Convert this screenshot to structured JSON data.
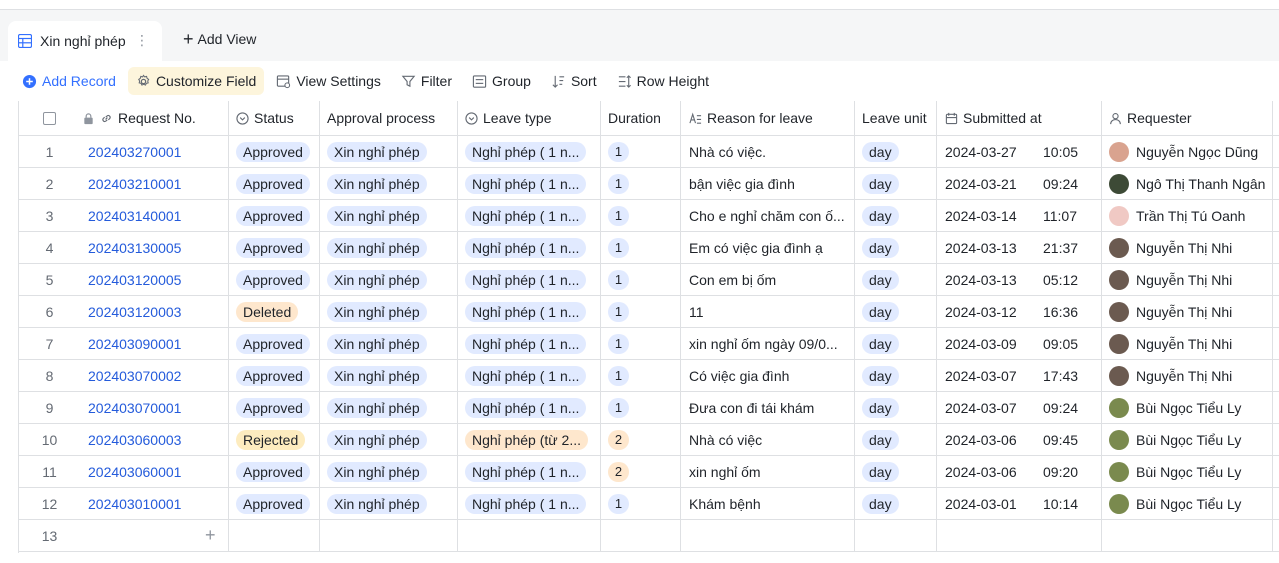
{
  "tabs": {
    "active_label": "Xin nghỉ phép",
    "add_view_label": "Add View"
  },
  "toolbar": {
    "add_record": "Add Record",
    "customize_field": "Customize Field",
    "view_settings": "View Settings",
    "filter": "Filter",
    "group": "Group",
    "sort": "Sort",
    "row_height": "Row Height"
  },
  "columns": {
    "request_no": "Request No.",
    "status": "Status",
    "approval_process": "Approval process",
    "leave_type": "Leave type",
    "duration": "Duration",
    "reason": "Reason for leave",
    "leave_unit": "Leave unit",
    "submitted_at": "Submitted at",
    "requester": "Requester"
  },
  "colors": {
    "accent": "#3370ff",
    "link": "#245bdb",
    "status_approved": "#e1eaff",
    "status_deleted": "#fee7cd",
    "status_rejected": "#fdecbf"
  },
  "rows": [
    {
      "idx": "1",
      "req": "202403270001",
      "status": "Approved",
      "approval": "Xin nghỉ phép",
      "type": "Nghỉ phép ( 1 n...",
      "duration": "1",
      "reason": "Nhà có việc.",
      "unit": "day",
      "date": "2024-03-27",
      "time": "10:05",
      "requester": "Nguyễn Ngọc Dũng",
      "avatar_color": "#d9a38f"
    },
    {
      "idx": "2",
      "req": "202403210001",
      "status": "Approved",
      "approval": "Xin nghỉ phép",
      "type": "Nghỉ phép ( 1 n...",
      "duration": "1",
      "reason": "bận việc gia đình",
      "unit": "day",
      "date": "2024-03-21",
      "time": "09:24",
      "requester": "Ngô Thị Thanh Ngân",
      "avatar_color": "#3d4a36"
    },
    {
      "idx": "3",
      "req": "202403140001",
      "status": "Approved",
      "approval": "Xin nghỉ phép",
      "type": "Nghỉ phép ( 1 n...",
      "duration": "1",
      "reason": "Cho e nghỉ chăm con ố...",
      "unit": "day",
      "date": "2024-03-14",
      "time": "11:07",
      "requester": "Trần Thị Tú Oanh",
      "avatar_color": "#f0c9c4"
    },
    {
      "idx": "4",
      "req": "202403130005",
      "status": "Approved",
      "approval": "Xin nghỉ phép",
      "type": "Nghỉ phép ( 1 n...",
      "duration": "1",
      "reason": "Em có việc gia đình ạ",
      "unit": "day",
      "date": "2024-03-13",
      "time": "21:37",
      "requester": "Nguyễn Thị  Nhi",
      "avatar_color": "#6b5a50"
    },
    {
      "idx": "5",
      "req": "202403120005",
      "status": "Approved",
      "approval": "Xin nghỉ phép",
      "type": "Nghỉ phép ( 1 n...",
      "duration": "1",
      "reason": "Con em bị ốm",
      "unit": "day",
      "date": "2024-03-13",
      "time": "05:12",
      "requester": "Nguyễn Thị  Nhi",
      "avatar_color": "#6b5a50"
    },
    {
      "idx": "6",
      "req": "202403120003",
      "status": "Deleted",
      "approval": "Xin nghỉ phép",
      "type": "Nghỉ phép ( 1 n...",
      "duration": "1",
      "reason": "11",
      "unit": "day",
      "date": "2024-03-12",
      "time": "16:36",
      "requester": "Nguyễn Thị  Nhi",
      "avatar_color": "#6b5a50"
    },
    {
      "idx": "7",
      "req": "202403090001",
      "status": "Approved",
      "approval": "Xin nghỉ phép",
      "type": "Nghỉ phép ( 1 n...",
      "duration": "1",
      "reason": "xin nghỉ ốm ngày 09/0...",
      "unit": "day",
      "date": "2024-03-09",
      "time": "09:05",
      "requester": "Nguyễn Thị  Nhi",
      "avatar_color": "#6b5a50"
    },
    {
      "idx": "8",
      "req": "202403070002",
      "status": "Approved",
      "approval": "Xin nghỉ phép",
      "type": "Nghỉ phép ( 1 n...",
      "duration": "1",
      "reason": "Có việc gia đình",
      "unit": "day",
      "date": "2024-03-07",
      "time": "17:43",
      "requester": "Nguyễn Thị  Nhi",
      "avatar_color": "#6b5a50"
    },
    {
      "idx": "9",
      "req": "202403070001",
      "status": "Approved",
      "approval": "Xin nghỉ phép",
      "type": "Nghỉ phép ( 1 n...",
      "duration": "1",
      "reason": "Đưa con đi tái khám",
      "unit": "day",
      "date": "2024-03-07",
      "time": "09:24",
      "requester": "Bùi Ngọc Tiểu Ly",
      "avatar_color": "#7a8a4e"
    },
    {
      "idx": "10",
      "req": "202403060003",
      "status": "Rejected",
      "approval": "Xin nghỉ phép",
      "type": "Nghỉ phép (từ 2...",
      "duration": "2",
      "reason": "Nhà có việc",
      "unit": "day",
      "date": "2024-03-06",
      "time": "09:45",
      "requester": "Bùi Ngọc Tiểu Ly",
      "avatar_color": "#7a8a4e"
    },
    {
      "idx": "11",
      "req": "202403060001",
      "status": "Approved",
      "approval": "Xin nghỉ phép",
      "type": "Nghỉ phép ( 1 n...",
      "duration": "2",
      "reason": "xin nghỉ ốm",
      "unit": "day",
      "date": "2024-03-06",
      "time": "09:20",
      "requester": "Bùi Ngọc Tiểu Ly",
      "avatar_color": "#7a8a4e"
    },
    {
      "idx": "12",
      "req": "202403010001",
      "status": "Approved",
      "approval": "Xin nghỉ phép",
      "type": "Nghỉ phép ( 1 n...",
      "duration": "1",
      "reason": "Khám bệnh",
      "unit": "day",
      "date": "2024-03-01",
      "time": "10:14",
      "requester": "Bùi Ngọc Tiểu Ly",
      "avatar_color": "#7a8a4e"
    }
  ],
  "new_row_index": "13"
}
